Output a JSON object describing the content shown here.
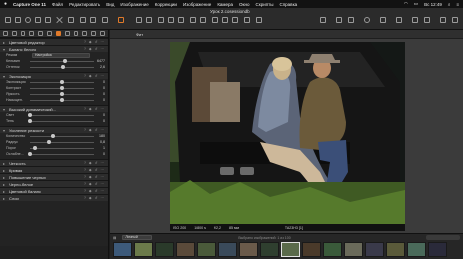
{
  "menubar": {
    "app": "Capture One 11",
    "items": [
      "Файл",
      "Редактировать",
      "Вид",
      "Изображение",
      "Коррекции",
      "Изображение",
      "Камера",
      "Окно",
      "Скрипты",
      "Справка"
    ],
    "clock": "Вс 12:49"
  },
  "window": {
    "title": "Урок 2.cosessiondb"
  },
  "viewer": {
    "fit_label": "Фит"
  },
  "left_panel": {
    "sections": [
      {
        "title": "Цветовой редактор",
        "rows": []
      },
      {
        "title": "Баланс белого",
        "rows": [
          {
            "label": "Режим",
            "type": "dropdown",
            "value": "Настройка"
          },
          {
            "label": "Кельвин",
            "type": "slider",
            "value": "6477",
            "knob": 0.55
          },
          {
            "label": "Оттенок",
            "type": "slider",
            "value": "2,6",
            "knob": 0.52
          }
        ]
      },
      {
        "title": "Экспозиция",
        "rows": [
          {
            "label": "Экспозиция",
            "type": "slider",
            "value": "0",
            "knob": 0.5
          },
          {
            "label": "Контраст",
            "type": "slider",
            "value": "0",
            "knob": 0.5
          },
          {
            "label": "Яркость",
            "type": "slider",
            "value": "0",
            "knob": 0.5
          },
          {
            "label": "Насыщен.",
            "type": "slider",
            "value": "0",
            "knob": 0.5
          }
        ]
      },
      {
        "title": "Высокий динамический...",
        "rows": [
          {
            "label": "Свет",
            "type": "slider",
            "value": "0",
            "knob": 0.0
          },
          {
            "label": "Тень",
            "type": "slider",
            "value": "0",
            "knob": 0.0
          }
        ]
      },
      {
        "title": "Усиление резкости",
        "rows": [
          {
            "label": "Количество",
            "type": "slider",
            "value": "180",
            "knob": 0.36
          },
          {
            "label": "Радиус",
            "type": "slider",
            "value": "0,8",
            "knob": 0.3
          },
          {
            "label": "Порог",
            "type": "slider",
            "value": "1",
            "knob": 0.08
          },
          {
            "label": "Ослабле...",
            "type": "slider",
            "value": "0",
            "knob": 0.0
          }
        ]
      },
      {
        "title": "Четкость",
        "rows": []
      },
      {
        "title": "Кривая",
        "rows": []
      },
      {
        "title": "Повышение черных",
        "rows": []
      },
      {
        "title": "Черно-белое",
        "rows": []
      },
      {
        "title": "Цветовой баланс",
        "rows": []
      },
      {
        "title": "Слои",
        "rows": []
      }
    ]
  },
  "photo_info": {
    "iso": "ISO 200",
    "shutter": "1/800 s",
    "aperture": "f/2,2",
    "focal": "85 мм",
    "file": "TA23H3 [1]"
  },
  "filmstrip": {
    "filter": "Личный",
    "count_label": "Выбрано изображений: 1 из 100",
    "search_placeholder": "Поиск"
  }
}
